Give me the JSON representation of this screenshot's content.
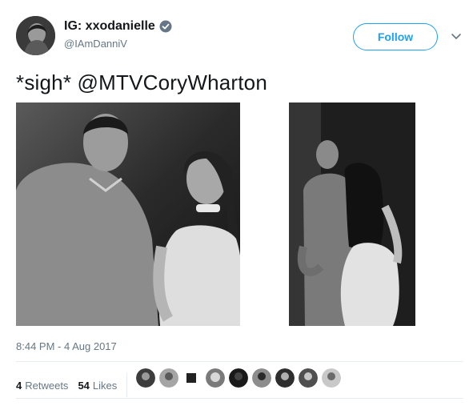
{
  "tweet": {
    "author": {
      "display_name": "IG: xxodanielle",
      "handle": "@IAmDanniV",
      "verified": true,
      "avatar_icon": "profile-photo"
    },
    "follow_label": "Follow",
    "more_icon": "chevron-down-icon",
    "text": "*sigh* @MTVCoryWharton",
    "timestamp": "8:44 PM - 4 Aug 2017",
    "stats": {
      "retweets_count": "4",
      "retweets_label": "Retweets",
      "likes_count": "54",
      "likes_label": "Likes"
    },
    "liker_avatar_count": 9
  },
  "colors": {
    "accent": "#1da1f2",
    "secondary_text": "#657786",
    "divider": "#e6ecf0"
  }
}
